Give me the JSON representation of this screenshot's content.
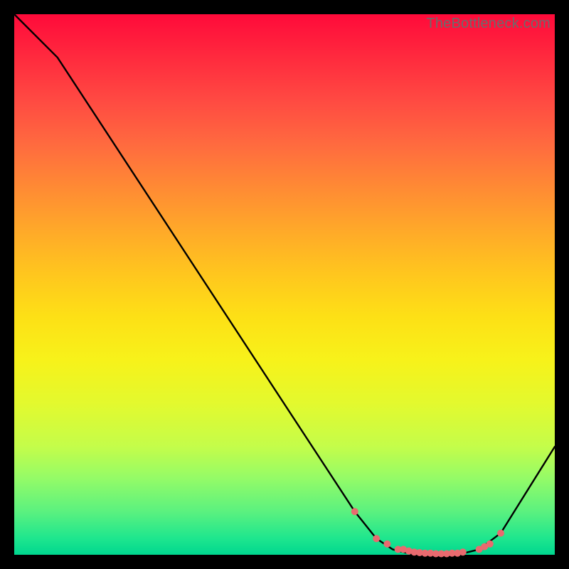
{
  "watermark": "TheBottleneck.com",
  "chart_data": {
    "type": "line",
    "title": "",
    "xlabel": "",
    "ylabel": "",
    "xlim": [
      0,
      100
    ],
    "ylim": [
      0,
      100
    ],
    "series": [
      {
        "name": "curve",
        "x": [
          0,
          8,
          63,
          67,
          70,
          74,
          78,
          82,
          86,
          90,
          100
        ],
        "values": [
          100,
          92,
          8,
          3,
          1,
          0,
          0,
          0,
          1,
          4,
          20
        ]
      }
    ],
    "markers": {
      "name": "points",
      "x": [
        63,
        67,
        69,
        71,
        72,
        73,
        74,
        75,
        76,
        77,
        78,
        79,
        80,
        81,
        82,
        83,
        86,
        87,
        88,
        90
      ],
      "values": [
        8,
        3,
        2,
        1,
        1,
        0.7,
        0.5,
        0.4,
        0.3,
        0.3,
        0.2,
        0.2,
        0.2,
        0.3,
        0.3,
        0.5,
        1,
        1.5,
        2,
        4
      ],
      "color": "#e96a6f",
      "radius": 5
    }
  }
}
